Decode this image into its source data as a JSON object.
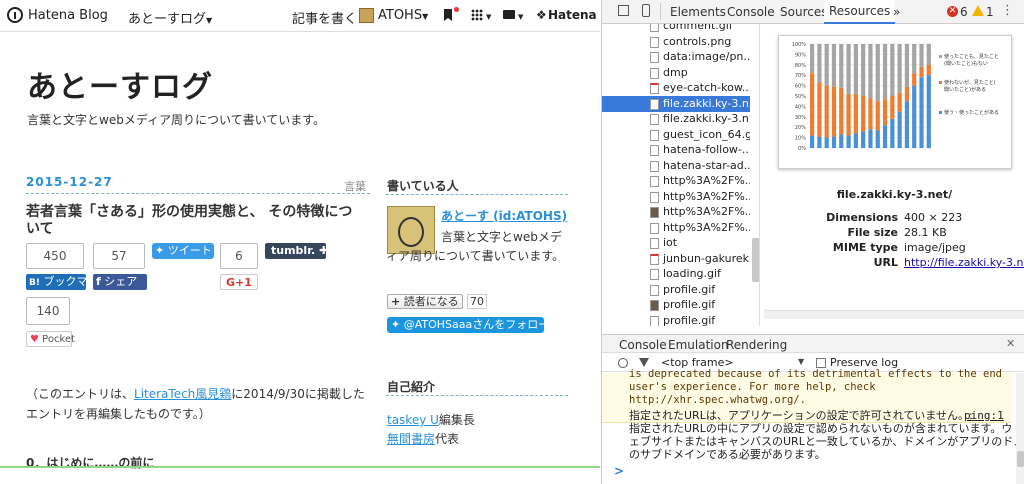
{
  "blog": {
    "brand": "Hatena Blog",
    "blog_menu": "あとーすログ",
    "write_label": "記事を書く",
    "user_menu": "ATOHS",
    "hatena_label": "Hatena",
    "title": "あとーすログ",
    "description": "言葉と文字とwebメディア周りについて書いています。",
    "post": {
      "date": "2015-12-27",
      "category": "言葉",
      "title": "若者言葉「さある」形の使用実態と、 その特徴について",
      "shares": {
        "bookmark_count": "450",
        "bookmark_label": "ブックマ",
        "facebook_count": "57",
        "facebook_label": "シェア",
        "tweet_label": "ツイート",
        "gplus_count": "6",
        "gplus_label": "G+1",
        "tumblr_label": "tumblr.",
        "pocket_count": "140",
        "pocket_label": "Pocket"
      },
      "intro_pre": "（このエントリは、",
      "intro_link": "LiteraTech風見鶏",
      "intro_post": "に2014/9/30に掲載したエントリを再編集したものです。）",
      "heading": "0．はじめに……の前に"
    },
    "sidebar": {
      "author_heading": "書いている人",
      "author_name": "あとーす (id:ATOHS)",
      "author_desc": "言葉と文字とwebメディア周りについて書いています。",
      "reader_label": "読者になる",
      "reader_count": "70",
      "follow_label": "@ATOHSaaaさんをフォロー",
      "intro_heading": "自己紹介",
      "intro_line1_link": "taskey U",
      "intro_line1_rest": "編集長",
      "intro_line2_link": "無間書房",
      "intro_line2_rest": "代表"
    }
  },
  "devtools": {
    "tabs": [
      "Elements",
      "Console",
      "Sources",
      "Resources"
    ],
    "active_tab": "Resources",
    "more_tabs": "»",
    "error_count": "6",
    "warning_count": "1",
    "resources": [
      "comment.gif",
      "controls.png",
      "data:image/pn...",
      "dmp",
      "eye-catch-kow...",
      "file.zakki.ky-3.n...",
      "file.zakki.ky-3.n...",
      "guest_icon_64.gif",
      "hatena-follow-...",
      "hatena-star-ad...",
      "http%3A%2F%...",
      "http%3A%2F%...",
      "http%3A%2F%...",
      "http%3A%2F%...",
      "iot",
      "junbun-gakureki",
      "loading.gif",
      "profile.gif",
      "profile.gif",
      "profile.gif",
      "profile.gif",
      "profile.gif"
    ],
    "selected_index": 5,
    "preview": {
      "name": "file.zakki.ky-3.net/",
      "dimensions_label": "Dimensions",
      "dimensions": "400 × 223",
      "filesize_label": "File size",
      "filesize": "28.1 KB",
      "mime_label": "MIME type",
      "mime": "image/jpeg",
      "url_label": "URL",
      "url": "http://file.zakki.ky-3.net/",
      "chart_legend": [
        "使ったことも、見たこと(聞いたこと)もない",
        "使わないが、見たこと(聞いたこと)がある",
        "使う・使ったことがある"
      ],
      "chart_yticks": [
        "100%",
        "90%",
        "80%",
        "70%",
        "60%",
        "50%",
        "40%",
        "30%",
        "20%",
        "10%",
        "0%"
      ]
    },
    "drawer_tabs": [
      "Console",
      "Emulation",
      "Rendering"
    ],
    "frame_label": "<top frame>",
    "preserve_log": "Preserve log",
    "console_lines": [
      "is deprecated because of its detrimental effects to the end",
      "user's experience. For more help, check",
      "http://xhr.spec.whatwg.org/.",
      "指定されたURLは、アプリケーションの設定で許可されていません。:",
      "指定されたURLの中にアプリの設定で認められないものが含まれています。ウ",
      "ェブサイトまたはキャンバスのURLと一致しているか、ドメインがアプリのドメイン",
      "のサブドメインである必要があります。"
    ],
    "console_source": "ping:1",
    "prompt": ">"
  }
}
